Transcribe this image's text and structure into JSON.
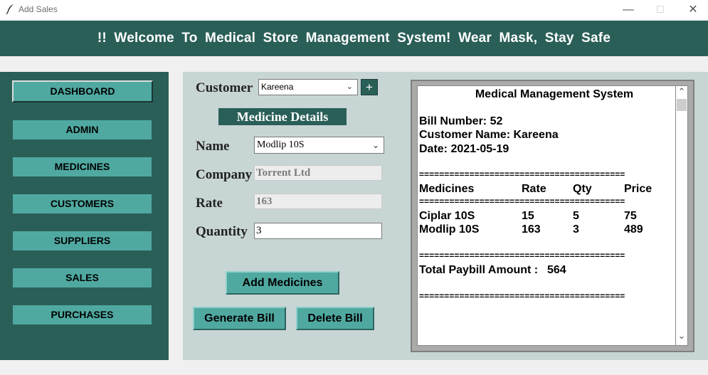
{
  "window": {
    "title": "Add Sales",
    "minimize": "—",
    "maximize": "☐",
    "close": "✕"
  },
  "banner": {
    "text": "!!  Welcome To Medical Store Management System! Wear Mask, Stay Safe"
  },
  "sidebar": {
    "items": [
      {
        "label": "DASHBOARD"
      },
      {
        "label": "ADMIN"
      },
      {
        "label": "MEDICINES"
      },
      {
        "label": "CUSTOMERS"
      },
      {
        "label": "SUPPLIERS"
      },
      {
        "label": "SALES"
      },
      {
        "label": "PURCHASES"
      }
    ]
  },
  "form": {
    "customer_label": "Customer",
    "customer_value": "Kareena",
    "add_customer_label": "+",
    "section_title": "Medicine Details",
    "name_label": "Name",
    "name_value": "Modlip 10S",
    "company_label": "Company",
    "company_value": "Torrent Ltd",
    "rate_label": "Rate",
    "rate_value": "163",
    "quantity_label": "Quantity",
    "quantity_value": "3",
    "add_medicines_label": "Add Medicines",
    "generate_bill_label": "Generate Bill",
    "delete_bill_label": "Delete Bill"
  },
  "bill": {
    "title": "Medical Management System",
    "bill_number": "Bill Number: 52",
    "customer_name": "Customer Name: Kareena",
    "date": "Date: 2021-05-19",
    "separator": "=========================================",
    "headers": {
      "medicines": "Medicines",
      "rate": "Rate",
      "qty": "Qty",
      "price": "Price"
    },
    "rows": [
      {
        "medicine": "Ciplar 10S",
        "rate": "15",
        "qty": "5",
        "price": "75"
      },
      {
        "medicine": "Modlip 10S",
        "rate": "163",
        "qty": "3",
        "price": "489"
      }
    ],
    "total_label": "Total Paybill Amount :",
    "total_value": "564"
  },
  "scrollbar": {
    "up": "⌃",
    "down": "⌄"
  }
}
